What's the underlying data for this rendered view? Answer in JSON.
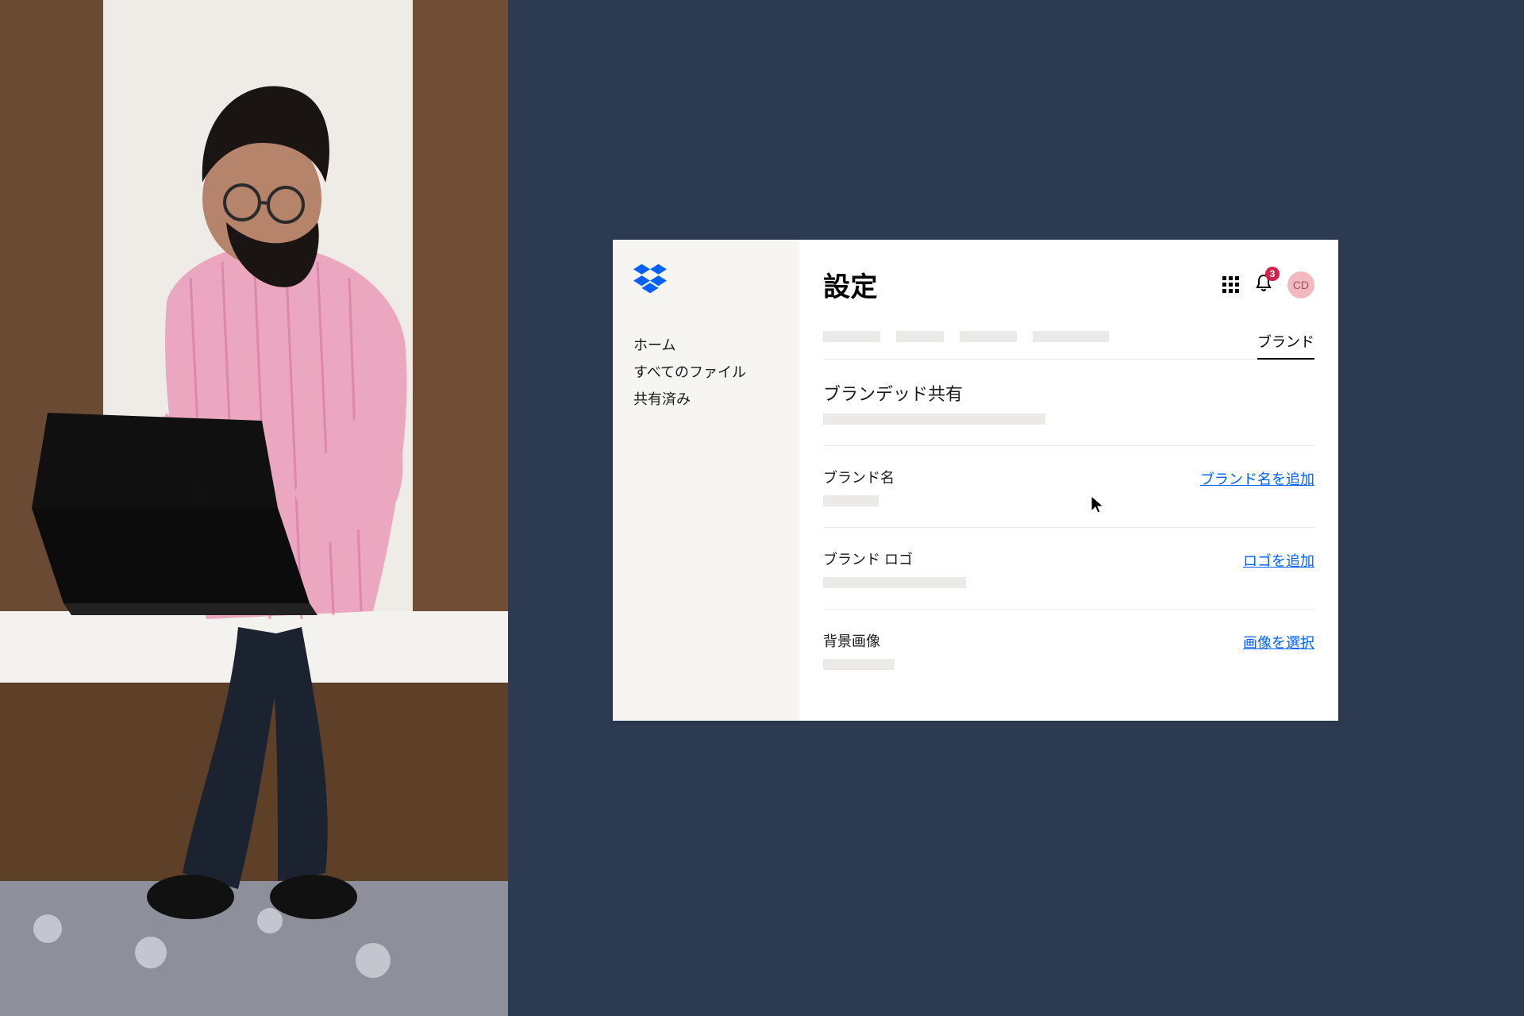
{
  "colors": {
    "background_dark": "#2c3a52",
    "sidebar_bg": "#f7f5f2",
    "link_blue": "#0061fe",
    "badge_red": "#d6204b",
    "avatar_bg": "#f2b9bf"
  },
  "sidebar": {
    "logo_name": "dropbox-logo",
    "items": [
      {
        "label": "ホーム"
      },
      {
        "label": "すべてのファイル"
      },
      {
        "label": "共有済み"
      }
    ]
  },
  "header": {
    "title": "設定",
    "notification_count": "3",
    "avatar_initials": "CD"
  },
  "tabs": {
    "active_label": "ブランド"
  },
  "sections": {
    "branded_sharing": {
      "title": "ブランデッド共有"
    },
    "brand_name": {
      "title": "ブランド名",
      "action": "ブランド名を追加"
    },
    "brand_logo": {
      "title": "ブランド ロゴ",
      "action": "ロゴを追加"
    },
    "background_image": {
      "title": "背景画像",
      "action": "画像を選択"
    }
  }
}
